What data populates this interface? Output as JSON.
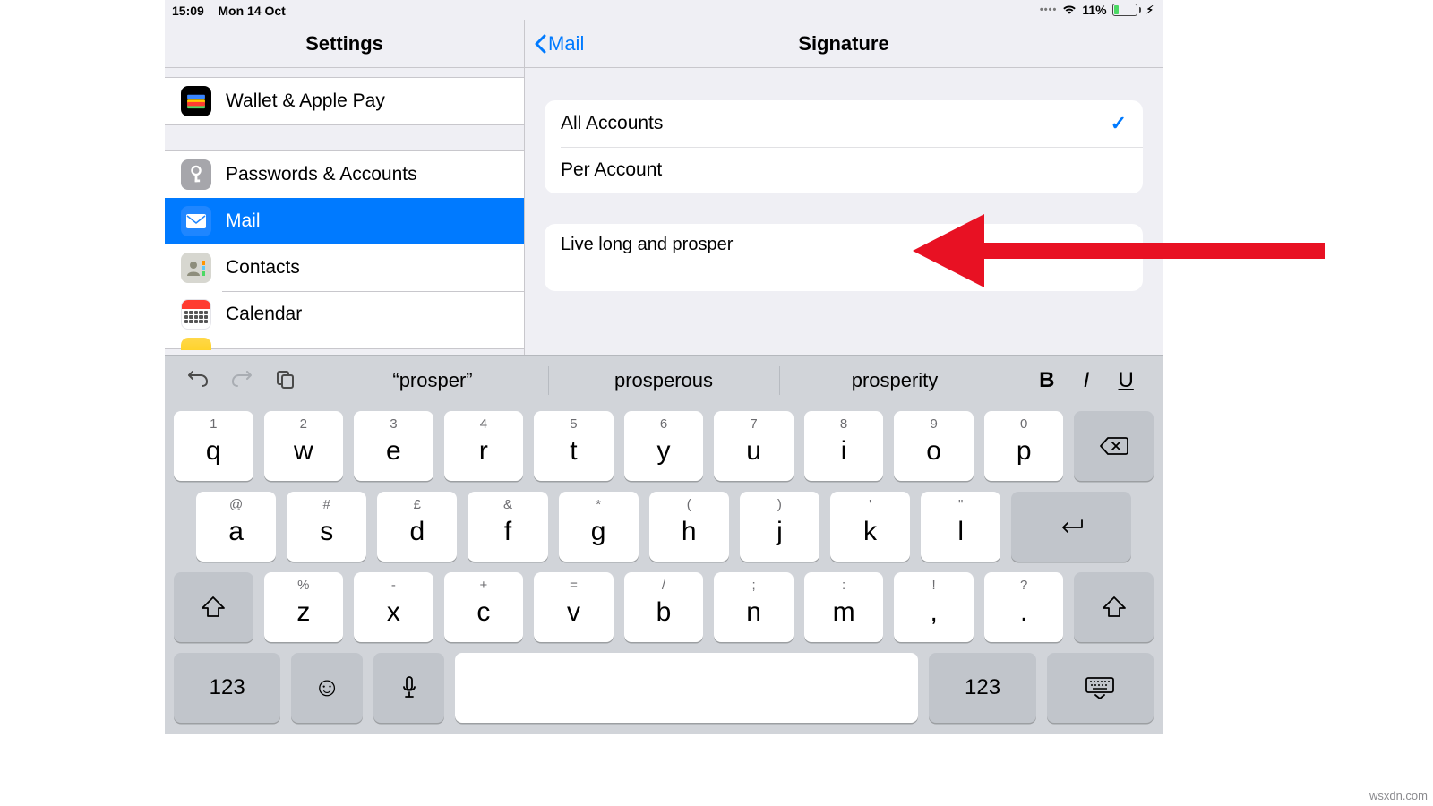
{
  "status": {
    "time": "15:09",
    "date": "Mon 14 Oct",
    "battery_pct": "11%"
  },
  "left": {
    "title": "Settings",
    "rows": {
      "wallet": "Wallet & Apple Pay",
      "passwords": "Passwords & Accounts",
      "mail": "Mail",
      "contacts": "Contacts",
      "calendar": "Calendar"
    }
  },
  "right": {
    "back": "Mail",
    "title": "Signature",
    "options": {
      "all": "All Accounts",
      "per": "Per Account"
    },
    "signature_text": "Live long and prosper"
  },
  "keyboard": {
    "suggestions": [
      "“prosper”",
      "prosperous",
      "prosperity"
    ],
    "format": {
      "b": "B",
      "i": "I",
      "u": "U"
    },
    "row1": [
      {
        "alt": "1",
        "main": "q"
      },
      {
        "alt": "2",
        "main": "w"
      },
      {
        "alt": "3",
        "main": "e"
      },
      {
        "alt": "4",
        "main": "r"
      },
      {
        "alt": "5",
        "main": "t"
      },
      {
        "alt": "6",
        "main": "y"
      },
      {
        "alt": "7",
        "main": "u"
      },
      {
        "alt": "8",
        "main": "i"
      },
      {
        "alt": "9",
        "main": "o"
      },
      {
        "alt": "0",
        "main": "p"
      }
    ],
    "row2": [
      {
        "alt": "@",
        "main": "a"
      },
      {
        "alt": "#",
        "main": "s"
      },
      {
        "alt": "£",
        "main": "d"
      },
      {
        "alt": "&",
        "main": "f"
      },
      {
        "alt": "*",
        "main": "g"
      },
      {
        "alt": "(",
        "main": "h"
      },
      {
        "alt": ")",
        "main": "j"
      },
      {
        "alt": "'",
        "main": "k"
      },
      {
        "alt": "\"",
        "main": "l"
      }
    ],
    "row3": [
      {
        "alt": "%",
        "main": "z"
      },
      {
        "alt": "-",
        "main": "x"
      },
      {
        "alt": "+",
        "main": "c"
      },
      {
        "alt": "=",
        "main": "v"
      },
      {
        "alt": "/",
        "main": "b"
      },
      {
        "alt": ";",
        "main": "n"
      },
      {
        "alt": ":",
        "main": "m"
      },
      {
        "alt": "!",
        "main": ","
      },
      {
        "alt": "?",
        "main": "."
      }
    ],
    "numkey": "123"
  },
  "watermark": "wsxdn.com"
}
